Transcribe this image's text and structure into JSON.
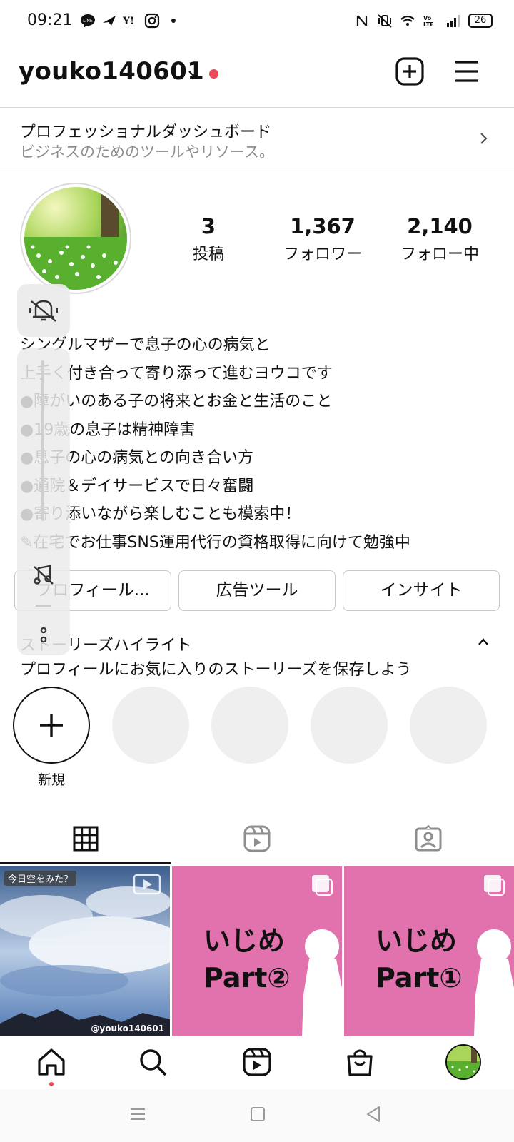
{
  "status_bar": {
    "time": "09:21",
    "battery": "26"
  },
  "header": {
    "username": "youko140601"
  },
  "dashboard": {
    "title": "プロフェッショナルダッシュボード",
    "subtitle": "ビジネスのためのツールやリソース。"
  },
  "stats": {
    "posts_count": "3",
    "posts_label": "投稿",
    "followers_count": "1,367",
    "followers_label": "フォロワー",
    "following_count": "2,140",
    "following_label": "フォロー中"
  },
  "bio": {
    "lines": [
      "シングルマザーで息子の心の病気と",
      "上手く付き合って寄り添って進むヨウコです",
      "●障がいのある子の将来とお金と生活のこと",
      "●19歳の息子は精神障害",
      "●息子の心の病気との向き合い方",
      "●通院＆デイサービスで日々奮闘",
      "●寄り添いながら楽しむことも模索中！",
      "✎在宅でお仕事SNS運用代行の資格取得に向けて勉強中"
    ]
  },
  "actions": {
    "edit_profile": "プロフィール...",
    "ad_tools": "広告ツール",
    "insights": "インサイト"
  },
  "highlights": {
    "title": "ストーリーズハイライト",
    "subtitle": "プロフィールにお気に入りのストーリーズを保存しよう",
    "new_label": "新規"
  },
  "posts": [
    {
      "tag": "今日空をみた？",
      "watermark": "@youko140601"
    },
    {
      "line1": "いじめ",
      "line2": "Part②"
    },
    {
      "line1": "いじめ",
      "line2": "Part①"
    }
  ],
  "colors": {
    "accent_red": "#ed4956",
    "post_pink": "#e272ad",
    "muted": "#8e8e8e"
  }
}
